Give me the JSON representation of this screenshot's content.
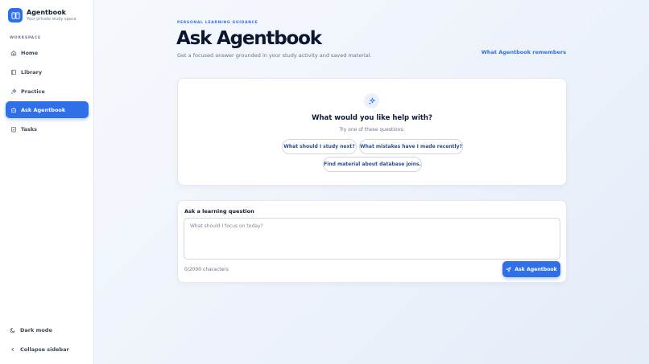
{
  "brand": {
    "title": "Agentbook",
    "subtitle": "Your private study space"
  },
  "sidebar": {
    "section_label": "WORKSPACE",
    "items": [
      {
        "label": "Home",
        "icon": "home-icon"
      },
      {
        "label": "Library",
        "icon": "book-icon"
      },
      {
        "label": "Practice",
        "icon": "sparkle-icon"
      },
      {
        "label": "Ask Agentbook",
        "icon": "robot-icon",
        "active": true
      },
      {
        "label": "Tasks",
        "icon": "checklist-icon"
      }
    ],
    "dark_mode": "Dark mode",
    "collapse": "Collapse sidebar"
  },
  "header": {
    "eyebrow": "PERSONAL LEARNING GUIDANCE",
    "title": "Ask Agentbook",
    "subtitle": "Get a focused answer grounded in your study activity and saved material.",
    "remembers_link": "What Agentbook remembers"
  },
  "help": {
    "title": "What would you like help with?",
    "subtitle": "Try one of these questions:",
    "suggestions": [
      "What should I study next?",
      "What mistakes have I made recently?",
      "Find material about database joins."
    ]
  },
  "ask": {
    "label": "Ask a learning question",
    "placeholder": "What should I focus on today?",
    "value": "",
    "char_count": "0/2000 characters",
    "button": "Ask Agentbook"
  },
  "colors": {
    "accent": "#2f6fe8",
    "text": "#0f1b33",
    "muted": "#6b7588"
  }
}
